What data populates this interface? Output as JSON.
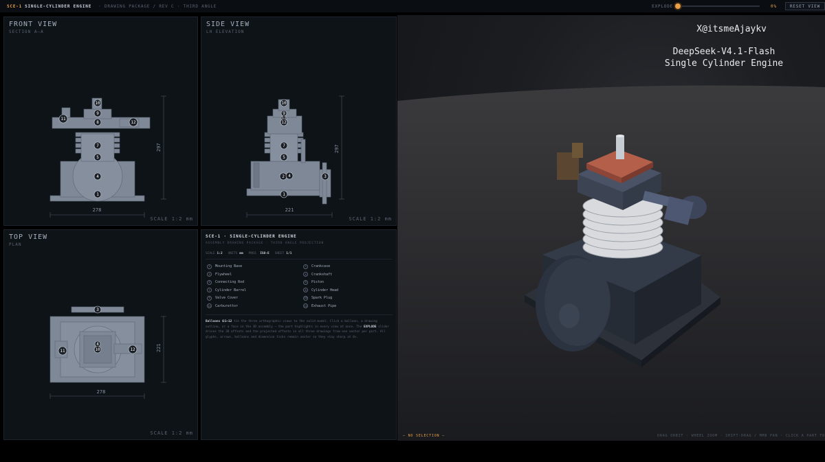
{
  "header": {
    "code": "SCE-1",
    "title": "SINGLE-CYLINDER ENGINE",
    "subtitle": "· DRAWING PACKAGE / REV C · THIRD ANGLE",
    "explode_label": "EXPLODE",
    "explode_value": 0,
    "explode_text": "0%",
    "reset_label": "RESET VIEW"
  },
  "views": {
    "front": {
      "title": "FRONT VIEW",
      "subtitle": "SECTION A–A",
      "scale": "SCALE 1:2 mm",
      "dim_h": "297",
      "dim_w": "278"
    },
    "side": {
      "title": "SIDE VIEW",
      "subtitle": "LH ELEVATION",
      "scale": "SCALE 1:2 mm",
      "dim_h": "297",
      "dim_w": "221"
    },
    "top": {
      "title": "TOP VIEW",
      "subtitle": "PLAN",
      "scale": "SCALE 1:2 mm",
      "dim_h": "221",
      "dim_w": "278"
    }
  },
  "info": {
    "title": "SCE-1 · SINGLE-CYLINDER ENGINE",
    "subtitle": "ASSEMBLY DRAWING PACKAGE · THIRD ANGLE PROJECTION",
    "meta": [
      {
        "k": "SCALE",
        "v": "1:2"
      },
      {
        "k": "UNITS",
        "v": "mm"
      },
      {
        "k": "PROJ.",
        "v": "ISO-E"
      },
      {
        "k": "SHEET",
        "v": "1/1"
      }
    ],
    "parts": [
      {
        "n": "1",
        "label": "Mounting Base"
      },
      {
        "n": "2",
        "label": "Crankcase"
      },
      {
        "n": "3",
        "label": "Flywheel"
      },
      {
        "n": "4",
        "label": "Crankshaft"
      },
      {
        "n": "5",
        "label": "Connecting Rod"
      },
      {
        "n": "6",
        "label": "Piston"
      },
      {
        "n": "7",
        "label": "Cylinder Barrel"
      },
      {
        "n": "8",
        "label": "Cylinder Head"
      },
      {
        "n": "9",
        "label": "Valve Cover"
      },
      {
        "n": "10",
        "label": "Spark Plug"
      },
      {
        "n": "11",
        "label": "Carburettor"
      },
      {
        "n": "12",
        "label": "Exhaust Pipe"
      }
    ],
    "desc_bold1": "Balloons ①1–12",
    "desc1": " tie the three orthographic views to the solid model. Click a balloon, a drawing outline, or a face in the 3D assembly — the part highlights in every view at once. The ",
    "desc_bold2": "EXPLODE",
    "desc2": " slider drives the 3D offsets and the projected offsets in all three drawings from one vector per part. All glyphs, arrows, balloons and dimension ticks remain vector so they stay sharp at 8×."
  },
  "viewport": {
    "credit": "X@itsmeAjaykv",
    "model_line1": "DeepSeek-V4.1-Flash",
    "model_line2": "Single Cylinder Engine"
  },
  "status": {
    "selection": "— NO SELECTION —",
    "hint": "DRAG ORBIT · WHEEL ZOOM · SHIFT-DRAG / MMB PAN · CLICK A PART TO"
  },
  "colors": {
    "accent": "#e8a04a",
    "drawing": "#7f8897",
    "panel": "#0e1318"
  }
}
